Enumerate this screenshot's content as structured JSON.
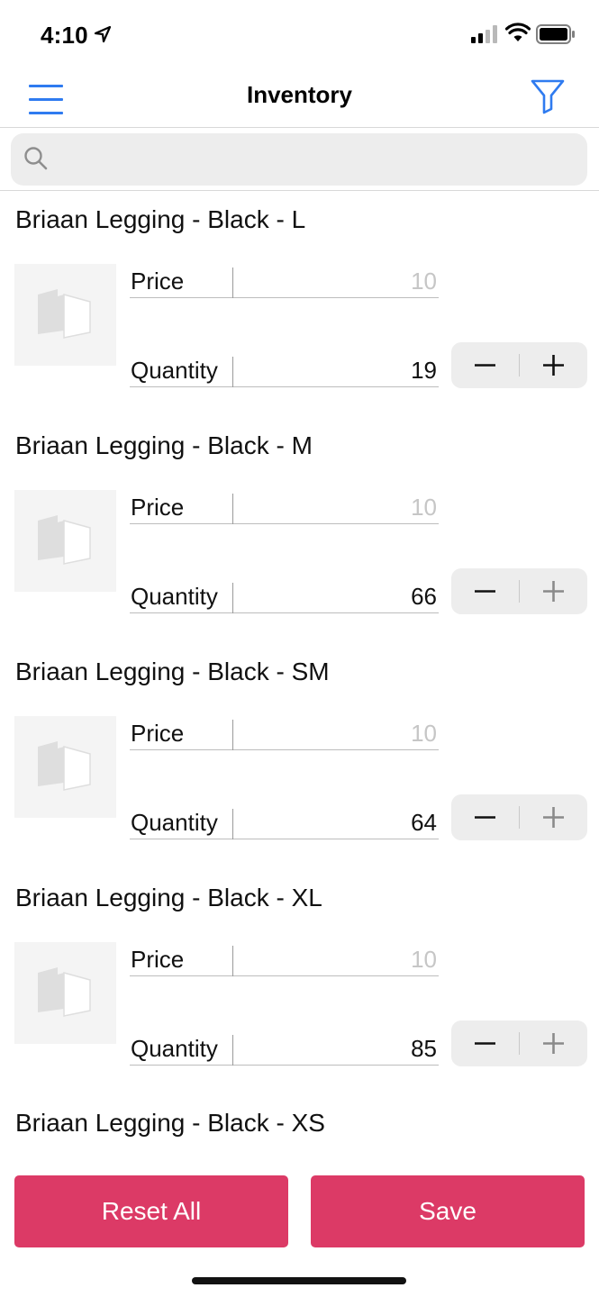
{
  "status_bar": {
    "time": "4:10"
  },
  "nav": {
    "title": "Inventory"
  },
  "search": {
    "placeholder": ""
  },
  "labels": {
    "price": "Price",
    "quantity": "Quantity"
  },
  "items": [
    {
      "title": "Briaan Legging - Black - L",
      "price": "10",
      "quantity": "19"
    },
    {
      "title": "Briaan Legging - Black - M",
      "price": "10",
      "quantity": "66"
    },
    {
      "title": "Briaan Legging - Black - SM",
      "price": "10",
      "quantity": "64"
    },
    {
      "title": "Briaan Legging - Black - XL",
      "price": "10",
      "quantity": "85"
    },
    {
      "title": "Briaan Legging - Black - XS"
    }
  ],
  "buttons": {
    "reset": "Reset All",
    "save": "Save"
  },
  "colors": {
    "accent_blue": "#2f7bf0",
    "button_pink": "#dc3a66",
    "field_bg": "#ededed"
  },
  "icons": [
    "location-arrow-icon",
    "cellular-signal-icon",
    "wifi-icon",
    "battery-icon",
    "hamburger-menu-icon",
    "filter-icon",
    "search-icon",
    "image-placeholder-icon",
    "minus-icon",
    "plus-icon"
  ]
}
